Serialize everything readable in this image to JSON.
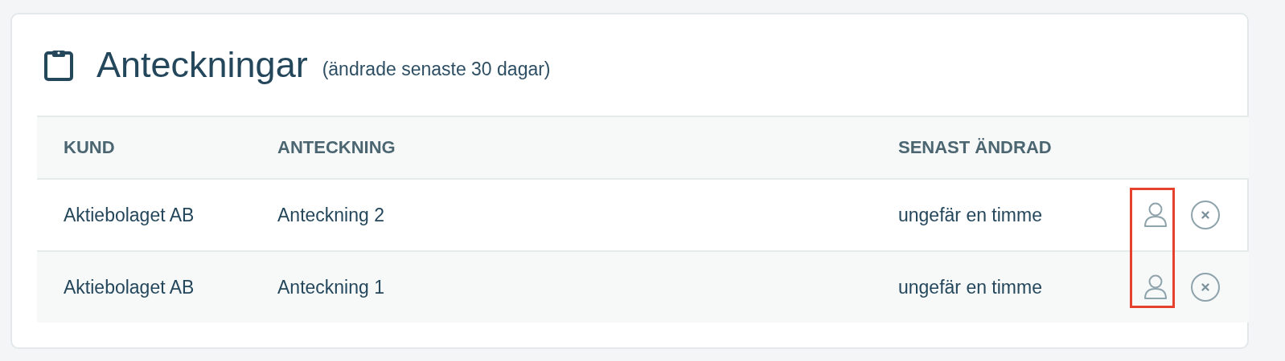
{
  "card": {
    "title": "Anteckningar",
    "subtitle": "(ändrade senaste 30 dagar)"
  },
  "table": {
    "columns": [
      "KUND",
      "ANTECKNING",
      "SENAST ÄNDRAD"
    ],
    "rows": [
      {
        "customer": "Aktiebolaget AB",
        "note": "Anteckning 2",
        "modified": "ungefär en timme"
      },
      {
        "customer": "Aktiebolaget AB",
        "note": "Anteckning 1",
        "modified": "ungefär en timme"
      }
    ]
  }
}
